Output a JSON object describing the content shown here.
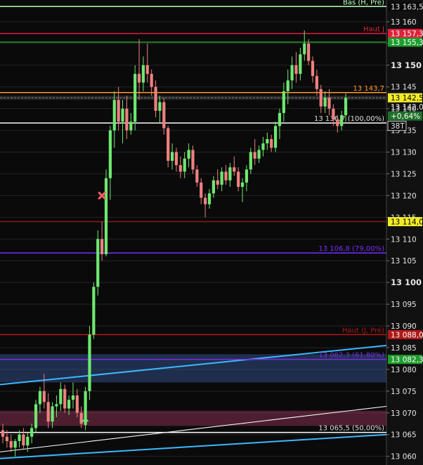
{
  "chart_data": {
    "type": "candlestick",
    "title": "",
    "xlabel": "",
    "ylabel": "",
    "ylim": [
      13058,
      13165
    ],
    "grid": true,
    "colors": {
      "background": "#0a0a0a",
      "axis_panel": "#111111",
      "up": "#6ee870",
      "down": "#f08080",
      "tick_text": "#e6e6e6"
    },
    "y_ticks": [
      13060,
      13065,
      13070,
      13075,
      13080,
      13085,
      13090,
      13095,
      13100,
      13105,
      13110,
      13115,
      13120,
      13125,
      13130,
      13135,
      13140,
      13145,
      13150,
      13155,
      13160
    ],
    "y_major_ticks": [
      13100,
      13150
    ],
    "candles": [
      {
        "o": 13066.0,
        "h": 13067.5,
        "l": 13063.0,
        "c": 13064.5
      },
      {
        "o": 13064.5,
        "h": 13066.0,
        "l": 13062.0,
        "c": 13063.5
      },
      {
        "o": 13063.5,
        "h": 13065.0,
        "l": 13061.0,
        "c": 13062.0
      },
      {
        "o": 13062.0,
        "h": 13064.0,
        "l": 13060.0,
        "c": 13063.5
      },
      {
        "o": 13063.5,
        "h": 13066.0,
        "l": 13062.0,
        "c": 13065.0
      },
      {
        "o": 13065.0,
        "h": 13066.5,
        "l": 13061.5,
        "c": 13062.5
      },
      {
        "o": 13062.5,
        "h": 13065.5,
        "l": 13061.0,
        "c": 13064.5
      },
      {
        "o": 13064.5,
        "h": 13067.5,
        "l": 13063.0,
        "c": 13066.5
      },
      {
        "o": 13066.5,
        "h": 13073.0,
        "l": 13065.5,
        "c": 13072.0
      },
      {
        "o": 13072.0,
        "h": 13076.0,
        "l": 13070.0,
        "c": 13075.0
      },
      {
        "o": 13075.0,
        "h": 13079.0,
        "l": 13071.0,
        "c": 13072.5
      },
      {
        "o": 13072.5,
        "h": 13074.5,
        "l": 13066.5,
        "c": 13068.0
      },
      {
        "o": 13068.0,
        "h": 13072.5,
        "l": 13066.5,
        "c": 13071.5
      },
      {
        "o": 13071.5,
        "h": 13074.0,
        "l": 13069.0,
        "c": 13072.0
      },
      {
        "o": 13072.0,
        "h": 13077.0,
        "l": 13070.5,
        "c": 13075.5
      },
      {
        "o": 13075.5,
        "h": 13076.5,
        "l": 13070.0,
        "c": 13071.0
      },
      {
        "o": 13071.0,
        "h": 13074.0,
        "l": 13069.5,
        "c": 13073.0
      },
      {
        "o": 13073.0,
        "h": 13077.0,
        "l": 13071.0,
        "c": 13074.0
      },
      {
        "o": 13074.0,
        "h": 13075.5,
        "l": 13069.0,
        "c": 13070.0
      },
      {
        "o": 13070.0,
        "h": 13071.5,
        "l": 13066.5,
        "c": 13067.5
      },
      {
        "o": 13067.5,
        "h": 13076.0,
        "l": 13066.0,
        "c": 13075.0
      },
      {
        "o": 13075.0,
        "h": 13090.0,
        "l": 13073.0,
        "c": 13088.0
      },
      {
        "o": 13088.0,
        "h": 13100.0,
        "l": 13087.0,
        "c": 13099.0
      },
      {
        "o": 13099.0,
        "h": 13112.0,
        "l": 13097.0,
        "c": 13110.0
      },
      {
        "o": 13110.0,
        "h": 13114.0,
        "l": 13105.0,
        "c": 13106.5
      },
      {
        "o": 13106.5,
        "h": 13126.0,
        "l": 13106.0,
        "c": 13124.0
      },
      {
        "o": 13124.0,
        "h": 13136.0,
        "l": 13119.0,
        "c": 13135.0
      },
      {
        "o": 13135.0,
        "h": 13144.0,
        "l": 13131.0,
        "c": 13142.0
      },
      {
        "o": 13142.0,
        "h": 13145.0,
        "l": 13135.0,
        "c": 13137.0
      },
      {
        "o": 13137.0,
        "h": 13142.0,
        "l": 13132.0,
        "c": 13140.0
      },
      {
        "o": 13140.0,
        "h": 13143.0,
        "l": 13133.0,
        "c": 13135.0
      },
      {
        "o": 13135.0,
        "h": 13139.0,
        "l": 13134.0,
        "c": 13137.0
      },
      {
        "o": 13137.0,
        "h": 13150.0,
        "l": 13135.0,
        "c": 13148.0
      },
      {
        "o": 13148.0,
        "h": 13156.0,
        "l": 13142.0,
        "c": 13146.0
      },
      {
        "o": 13146.0,
        "h": 13152.0,
        "l": 13144.0,
        "c": 13150.0
      },
      {
        "o": 13150.0,
        "h": 13155.0,
        "l": 13146.0,
        "c": 13148.0
      },
      {
        "o": 13148.0,
        "h": 13149.0,
        "l": 13143.0,
        "c": 13145.0
      },
      {
        "o": 13145.0,
        "h": 13146.5,
        "l": 13138.0,
        "c": 13139.5
      },
      {
        "o": 13139.5,
        "h": 13143.0,
        "l": 13136.5,
        "c": 13141.5
      },
      {
        "o": 13141.5,
        "h": 13142.5,
        "l": 13134.0,
        "c": 13135.5
      },
      {
        "o": 13135.5,
        "h": 13136.0,
        "l": 13126.5,
        "c": 13128.0
      },
      {
        "o": 13128.0,
        "h": 13132.0,
        "l": 13126.0,
        "c": 13130.0
      },
      {
        "o": 13130.0,
        "h": 13131.0,
        "l": 13125.5,
        "c": 13127.0
      },
      {
        "o": 13127.0,
        "h": 13129.0,
        "l": 13124.0,
        "c": 13125.5
      },
      {
        "o": 13125.5,
        "h": 13130.0,
        "l": 13124.0,
        "c": 13128.5
      },
      {
        "o": 13128.5,
        "h": 13132.0,
        "l": 13126.5,
        "c": 13130.5
      },
      {
        "o": 13130.5,
        "h": 13131.5,
        "l": 13125.0,
        "c": 13126.0
      },
      {
        "o": 13126.0,
        "h": 13127.0,
        "l": 13122.0,
        "c": 13123.0
      },
      {
        "o": 13123.0,
        "h": 13124.0,
        "l": 13118.0,
        "c": 13119.5
      },
      {
        "o": 13119.5,
        "h": 13120.5,
        "l": 13115.0,
        "c": 13118.0
      },
      {
        "o": 13118.0,
        "h": 13121.5,
        "l": 13117.0,
        "c": 13120.5
      },
      {
        "o": 13120.5,
        "h": 13124.5,
        "l": 13119.5,
        "c": 13123.5
      },
      {
        "o": 13123.5,
        "h": 13126.0,
        "l": 13121.5,
        "c": 13122.5
      },
      {
        "o": 13122.5,
        "h": 13126.5,
        "l": 13121.0,
        "c": 13125.5
      },
      {
        "o": 13125.5,
        "h": 13127.0,
        "l": 13122.5,
        "c": 13123.5
      },
      {
        "o": 13123.5,
        "h": 13127.5,
        "l": 13122.0,
        "c": 13126.5
      },
      {
        "o": 13126.5,
        "h": 13129.0,
        "l": 13124.5,
        "c": 13125.5
      },
      {
        "o": 13125.5,
        "h": 13126.5,
        "l": 13121.0,
        "c": 13122.0
      },
      {
        "o": 13122.0,
        "h": 13124.0,
        "l": 13118.5,
        "c": 13123.0
      },
      {
        "o": 13123.0,
        "h": 13127.0,
        "l": 13121.0,
        "c": 13126.0
      },
      {
        "o": 13126.0,
        "h": 13131.0,
        "l": 13125.0,
        "c": 13130.0
      },
      {
        "o": 13130.0,
        "h": 13133.0,
        "l": 13127.0,
        "c": 13128.5
      },
      {
        "o": 13128.5,
        "h": 13131.5,
        "l": 13127.5,
        "c": 13130.5
      },
      {
        "o": 13130.5,
        "h": 13133.5,
        "l": 13129.0,
        "c": 13132.0
      },
      {
        "o": 13132.0,
        "h": 13134.5,
        "l": 13130.5,
        "c": 13133.0
      },
      {
        "o": 13133.0,
        "h": 13134.0,
        "l": 13130.0,
        "c": 13131.0
      },
      {
        "o": 13131.0,
        "h": 13137.0,
        "l": 13130.0,
        "c": 13136.0
      },
      {
        "o": 13136.0,
        "h": 13140.0,
        "l": 13133.0,
        "c": 13139.0
      },
      {
        "o": 13139.0,
        "h": 13146.0,
        "l": 13137.0,
        "c": 13144.0
      },
      {
        "o": 13144.0,
        "h": 13149.0,
        "l": 13141.0,
        "c": 13146.5
      },
      {
        "o": 13146.5,
        "h": 13152.0,
        "l": 13144.5,
        "c": 13150.0
      },
      {
        "o": 13150.0,
        "h": 13153.0,
        "l": 13146.0,
        "c": 13148.0
      },
      {
        "o": 13148.0,
        "h": 13154.0,
        "l": 13146.5,
        "c": 13152.5
      },
      {
        "o": 13152.5,
        "h": 13158.0,
        "l": 13151.0,
        "c": 13155.0
      },
      {
        "o": 13155.0,
        "h": 13156.0,
        "l": 13150.0,
        "c": 13151.0
      },
      {
        "o": 13151.0,
        "h": 13152.0,
        "l": 13146.0,
        "c": 13147.5
      },
      {
        "o": 13147.5,
        "h": 13149.0,
        "l": 13143.0,
        "c": 13144.5
      },
      {
        "o": 13144.5,
        "h": 13145.5,
        "l": 13139.0,
        "c": 13140.5
      },
      {
        "o": 13140.5,
        "h": 13144.0,
        "l": 13139.0,
        "c": 13142.5
      },
      {
        "o": 13142.5,
        "h": 13144.5,
        "l": 13138.5,
        "c": 13140.0
      },
      {
        "o": 13140.0,
        "h": 13141.0,
        "l": 13136.0,
        "c": 13137.5
      },
      {
        "o": 13137.5,
        "h": 13138.5,
        "l": 13134.5,
        "c": 13136.0
      },
      {
        "o": 13136.0,
        "h": 13139.5,
        "l": 13135.0,
        "c": 13138.5
      },
      {
        "o": 13138.5,
        "h": 13143.5,
        "l": 13137.0,
        "c": 13142.5
      }
    ],
    "levels": [
      {
        "value": 13163.5,
        "label": "Bas (H, Pré)",
        "price": "13 163,5",
        "color": "#b8ffb8",
        "box_bg": "#0a0a0a",
        "box_fg": "#e6e6e6"
      },
      {
        "value": 13157.3,
        "label": "Haut J",
        "price": "13 157,3",
        "color": "#e0203a",
        "box_bg": "#e0203a",
        "box_fg": "#ffffff"
      },
      {
        "value": 13155.3,
        "label": "",
        "price": "13 155,3",
        "color": "#1f9d2e",
        "box_bg": "#1f9d2e",
        "box_fg": "#ffffff"
      },
      {
        "value": 13143.7,
        "label": "13 143,7",
        "price": "",
        "color": "#ff9a2e",
        "box_bg": "",
        "box_fg": ""
      },
      {
        "value": 13136.7,
        "label": "13 136,7 (100,00%)",
        "price": "",
        "color": "#ffffff",
        "box_bg": "",
        "box_fg": ""
      },
      {
        "value": 13114.0,
        "label": "",
        "price": "13 114,0",
        "color": "#8a1a1a",
        "box_bg": "#f2ec28",
        "box_fg": "#000000"
      },
      {
        "value": 13106.8,
        "label": "13 106,8 (79,00%)",
        "price": "",
        "color": "#7b2cff",
        "box_bg": "",
        "box_fg": ""
      },
      {
        "value": 13088.0,
        "label": "Haut (J, Pré)",
        "price": "13 088,0",
        "color": "#b01818",
        "box_bg": "#b01818",
        "box_fg": "#ffffff"
      },
      {
        "value": 13082.3,
        "label": "13 082,3 (61,80%)",
        "price": "13 082,3",
        "color": "#7a30e0",
        "box_bg": "#1f9d2e",
        "box_fg": "#ffffff"
      },
      {
        "value": 13065.5,
        "label": "13 065,5 (50,00%)",
        "price": "",
        "color": "#ffffff",
        "box_bg": "",
        "box_fg": ""
      }
    ],
    "current_price": {
      "value": 13142.5,
      "price": "13 142,5",
      "sub_price": "13 142,0",
      "change": "+0,64%",
      "volume": "38T"
    },
    "zones": [
      {
        "y_from": 13077.0,
        "y_to": 13083.5,
        "color": "#3a5a9e"
      },
      {
        "y_from": 13067.0,
        "y_to": 13070.5,
        "color": "#a03860"
      }
    ],
    "trendlines": [
      {
        "from": {
          "bar": 0,
          "y": 13061.0
        },
        "to": {
          "bar": 83,
          "y": 13071.5
        },
        "color": "#ffffff"
      },
      {
        "from": {
          "bar": 0,
          "y": 13059.5
        },
        "to": {
          "bar": 83,
          "y": 13065.0
        },
        "color": "#3cb8ff"
      },
      {
        "from": {
          "bar": 0,
          "y": 13076.5
        },
        "to": {
          "bar": 83,
          "y": 13085.5
        },
        "color": "#3cb8ff"
      }
    ],
    "markers": [
      {
        "bar": 20,
        "y": 13068.0,
        "shape": "up-arrow",
        "color": "#6ee870"
      },
      {
        "bar": 24,
        "y": 13120.0,
        "shape": "cross",
        "color": "#f06060"
      }
    ]
  }
}
